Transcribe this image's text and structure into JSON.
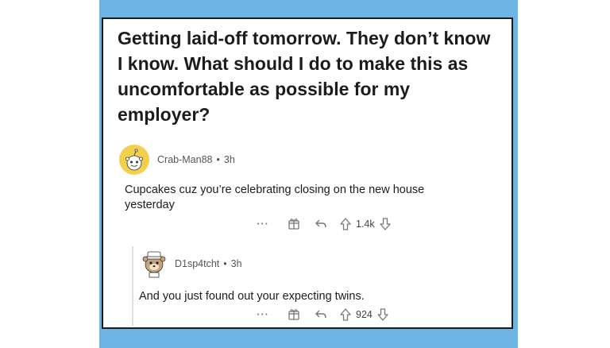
{
  "post": {
    "title": "Getting laid-off tomorrow. They don’t know I know. What should I do to make this as uncomfortable as possible for my employer?"
  },
  "comments": [
    {
      "author": "Crab-Man88",
      "separator": "•",
      "time": "3h",
      "body": "Cupcakes cuz you’re celebrating closing on the new house yesterday",
      "more": "···",
      "votes": "1.4k"
    },
    {
      "author": "D1sp4tcht",
      "separator": "•",
      "time": "3h",
      "body": "And you just found out your expecting twins.",
      "more": "···",
      "votes": "924"
    }
  ],
  "colors": {
    "background_blue": "#6cb4e4",
    "avatar_yellow": "#f2cf4d",
    "text": "#1c1c1c",
    "muted": "#777777"
  },
  "icons": [
    "snoo-avatar-icon",
    "award-icon",
    "reply-icon",
    "upvote-icon",
    "downvote-icon",
    "more-options-icon"
  ]
}
